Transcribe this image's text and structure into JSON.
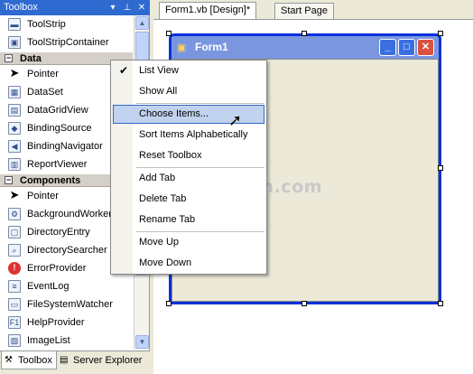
{
  "toolbox": {
    "title": "Toolbox",
    "controls": {
      "pin": "▾",
      "autohide": "⊥",
      "close": "✕"
    },
    "items": [
      {
        "type": "item",
        "label": "ToolStrip",
        "icon": "toolstrip-icon"
      },
      {
        "type": "item",
        "label": "ToolStripContainer",
        "icon": "toolstripcontainer-icon"
      },
      {
        "type": "group",
        "label": "Data",
        "expanded": true
      },
      {
        "type": "item",
        "label": "Pointer",
        "icon": "pointer-icon"
      },
      {
        "type": "item",
        "label": "DataSet",
        "icon": "dataset-icon"
      },
      {
        "type": "item",
        "label": "DataGridView",
        "icon": "datagridview-icon"
      },
      {
        "type": "item",
        "label": "BindingSource",
        "icon": "bindingsource-icon"
      },
      {
        "type": "item",
        "label": "BindingNavigator",
        "icon": "bindingnavigator-icon"
      },
      {
        "type": "item",
        "label": "ReportViewer",
        "icon": "reportviewer-icon"
      },
      {
        "type": "group",
        "label": "Components",
        "expanded": true
      },
      {
        "type": "item",
        "label": "Pointer",
        "icon": "pointer-icon"
      },
      {
        "type": "item",
        "label": "BackgroundWorker",
        "icon": "backgroundworker-icon"
      },
      {
        "type": "item",
        "label": "DirectoryEntry",
        "icon": "directoryentry-icon"
      },
      {
        "type": "item",
        "label": "DirectorySearcher",
        "icon": "directorysearcher-icon"
      },
      {
        "type": "item",
        "label": "ErrorProvider",
        "icon": "errorprovider-icon"
      },
      {
        "type": "item",
        "label": "EventLog",
        "icon": "eventlog-icon"
      },
      {
        "type": "item",
        "label": "FileSystemWatcher",
        "icon": "filesystemwatcher-icon"
      },
      {
        "type": "item",
        "label": "HelpProvider",
        "icon": "helpprovider-icon"
      },
      {
        "type": "item",
        "label": "ImageList",
        "icon": "imagelist-icon"
      }
    ]
  },
  "bottom_tabs": [
    {
      "label": "Toolbox",
      "icon": "toolbox-icon",
      "active": true
    },
    {
      "label": "Server Explorer",
      "icon": "server-explorer-icon",
      "active": false
    }
  ],
  "doc_tabs": [
    {
      "label": "Form1.vb [Design]*",
      "active": true
    },
    {
      "label": "Start Page",
      "active": false
    }
  ],
  "form": {
    "title": "Form1",
    "buttons": {
      "min": "_",
      "max": "□",
      "close": "✕"
    }
  },
  "watermark": "www.linglom.com",
  "context_menu": {
    "items": [
      {
        "label": "List View",
        "checked": true
      },
      {
        "label": "Show All",
        "checked": false
      },
      {
        "separator": true
      },
      {
        "label": "Choose Items...",
        "highlighted": true
      },
      {
        "label": "Sort Items Alphabetically"
      },
      {
        "label": "Reset Toolbox"
      },
      {
        "separator": true
      },
      {
        "label": "Add Tab"
      },
      {
        "label": "Delete Tab"
      },
      {
        "label": "Rename Tab"
      },
      {
        "separator": true
      },
      {
        "label": "Move Up"
      },
      {
        "label": "Move Down"
      }
    ]
  },
  "colors": {
    "titlebar_accent": "#2f6ad1",
    "menu_highlight": "#c1d2ee",
    "menu_highlight_border": "#316ac5",
    "form_titlebar": "#7a96df"
  }
}
